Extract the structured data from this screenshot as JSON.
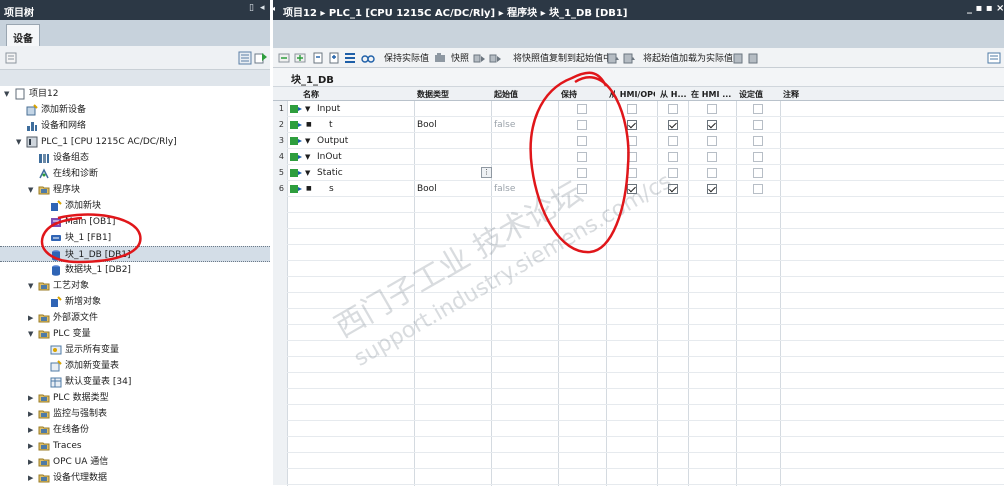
{
  "project_panel": {
    "title": "项目树",
    "devices_tab": "设备",
    "tree": [
      {
        "label": "项目12",
        "level": 0,
        "expanded": true,
        "icon": "project-icon"
      },
      {
        "label": "添加新设备",
        "level": 1,
        "icon": "add-device-icon"
      },
      {
        "label": "设备和网络",
        "level": 1,
        "icon": "network-icon"
      },
      {
        "label": "PLC_1 [CPU 1215C AC/DC/Rly]",
        "level": 1,
        "expanded": true,
        "icon": "plc-icon"
      },
      {
        "label": "设备组态",
        "level": 2,
        "icon": "device-config-icon"
      },
      {
        "label": "在线和诊断",
        "level": 2,
        "icon": "online-diagnostics-icon"
      },
      {
        "label": "程序块",
        "level": 2,
        "expanded": true,
        "icon": "folder-icon"
      },
      {
        "label": "添加新块",
        "level": 3,
        "icon": "add-block-icon"
      },
      {
        "label": "Main [OB1]",
        "level": 3,
        "icon": "ob-block-icon"
      },
      {
        "label": "块_1 [FB1]",
        "level": 3,
        "icon": "fb-block-icon"
      },
      {
        "label": "块_1_DB [DB1]",
        "level": 3,
        "icon": "db-block-icon",
        "selected": true
      },
      {
        "label": "数据块_1 [DB2]",
        "level": 3,
        "icon": "db-block-icon"
      },
      {
        "label": "工艺对象",
        "level": 2,
        "expanded": true,
        "icon": "folder-icon"
      },
      {
        "label": "新增对象",
        "level": 3,
        "icon": "add-object-icon"
      },
      {
        "label": "外部源文件",
        "level": 2,
        "expanded": false,
        "icon": "folder-icon"
      },
      {
        "label": "PLC 变量",
        "level": 2,
        "expanded": true,
        "icon": "folder-icon"
      },
      {
        "label": "显示所有变量",
        "level": 3,
        "icon": "show-tags-icon"
      },
      {
        "label": "添加新变量表",
        "level": 3,
        "icon": "add-tag-table-icon"
      },
      {
        "label": "默认变量表 [34]",
        "level": 3,
        "icon": "tag-table-icon"
      },
      {
        "label": "PLC 数据类型",
        "level": 2,
        "expanded": false,
        "icon": "folder-icon"
      },
      {
        "label": "监控与强制表",
        "level": 2,
        "expanded": false,
        "icon": "folder-icon"
      },
      {
        "label": "在线备份",
        "level": 2,
        "expanded": false,
        "icon": "folder-icon"
      },
      {
        "label": "Traces",
        "level": 2,
        "expanded": false,
        "icon": "folder-icon"
      },
      {
        "label": "OPC UA 通信",
        "level": 2,
        "expanded": false,
        "icon": "folder-icon"
      },
      {
        "label": "设备代理数据",
        "level": 2,
        "expanded": false,
        "icon": "folder-icon"
      }
    ]
  },
  "editor": {
    "breadcrumb": "项目12 ▸ PLC_1 [CPU 1215C AC/DC/Rly] ▸ 程序块 ▸ 块_1_DB [DB1]",
    "window_controls": "_ ▪ ▪ ×",
    "toolbar": {
      "keep_actual": "保持实际值",
      "snapshot": "快照",
      "copy_snapshot": "将快照值复制到起始值中",
      "load_start": "将起始值加载为实际值"
    },
    "db_title": "块_1_DB",
    "columns": {
      "name": "名称",
      "datatype": "数据类型",
      "start": "起始值",
      "retain": "保持",
      "hmi_opc": "从 HMI/OPC...",
      "from_h": "从 H...",
      "in_hmi": "在 HMI ...",
      "setpoint": "设定值",
      "comment": "注释"
    },
    "rows": [
      {
        "num": "1",
        "name": "Input",
        "section": true,
        "datatype": "",
        "start": "",
        "checks": [
          false,
          false,
          false,
          false,
          false
        ]
      },
      {
        "num": "2",
        "name": "t",
        "section": false,
        "datatype": "Bool",
        "start": "false",
        "checks": [
          false,
          true,
          true,
          true,
          false
        ]
      },
      {
        "num": "3",
        "name": "Output",
        "section": true,
        "datatype": "",
        "start": "",
        "checks": [
          false,
          false,
          false,
          false,
          false
        ]
      },
      {
        "num": "4",
        "name": "InOut",
        "section": true,
        "datatype": "",
        "start": "",
        "checks": [
          false,
          false,
          false,
          false,
          false
        ]
      },
      {
        "num": "5",
        "name": "Static",
        "section": true,
        "datatype": "",
        "start": "",
        "checks": [
          false,
          false,
          false,
          false,
          false
        ]
      },
      {
        "num": "6",
        "name": "s",
        "section": false,
        "datatype": "Bool",
        "start": "false",
        "checks": [
          false,
          true,
          true,
          true,
          false
        ]
      }
    ]
  },
  "watermark": {
    "line1": "西门子工业 技术论坛",
    "line2": "support.industry.siemens.com/cs"
  },
  "colors": {
    "title_bar": "#2c3845",
    "annotation_red": "#e0161a",
    "selection": "#d3dde7"
  }
}
